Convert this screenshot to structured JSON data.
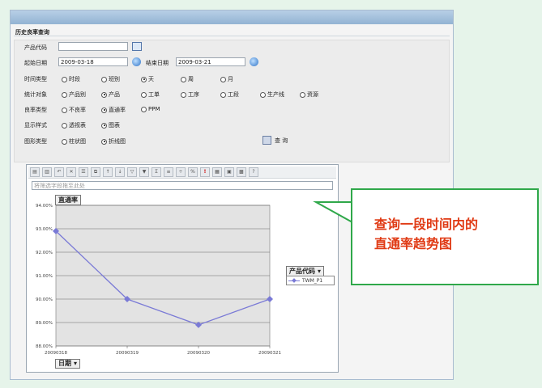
{
  "panel": {
    "title": "历史良率查询"
  },
  "form": {
    "product_code_label": "产品代码",
    "product_code_value": "",
    "start_date_label": "起始日期",
    "start_date_value": "2009-03-18",
    "end_date_label": "结束日期",
    "end_date_value": "2009-03-21",
    "time_type_label": "时间类型",
    "time_type_options": [
      "时段",
      "班别",
      "天",
      "周",
      "月"
    ],
    "time_type_selected": "天",
    "stat_object_label": "统计对象",
    "stat_object_options": [
      "产品别",
      "产品",
      "工单",
      "工序",
      "工段",
      "生产线",
      "资源"
    ],
    "stat_object_selected": "产品",
    "yield_type_label": "良率类型",
    "yield_type_options": [
      "不良率",
      "直通率",
      "PPM"
    ],
    "yield_type_selected": "直通率",
    "display_style_label": "显示样式",
    "display_style_options": [
      "透视表",
      "图表"
    ],
    "display_style_selected": "图表",
    "graph_type_label": "图形类型",
    "graph_type_options": [
      "柱状图",
      "折线图"
    ],
    "graph_type_selected": "折线图",
    "query_label": "查 询"
  },
  "pivot": {
    "filter_placeholder": "将筛选字段拖至此处",
    "measure_field": "直通率",
    "category_field": "日期",
    "series_field": "产品代码"
  },
  "chart_data": {
    "type": "line",
    "categories": [
      "20090318",
      "20090319",
      "20090320",
      "20090321"
    ],
    "series": [
      {
        "name": "TWM_P1",
        "values": [
          92.9,
          90.0,
          88.9,
          90.0
        ]
      }
    ],
    "ylim": [
      88.0,
      94.0
    ],
    "yticks": [
      "94.00%",
      "93.00%",
      "92.00%",
      "91.00%",
      "90.00%",
      "89.00%",
      "88.00%"
    ],
    "line_color": "#7a7ad6",
    "plot_bg": "#e3e3e3",
    "grid": true,
    "legend": "right"
  },
  "callout": {
    "line1": "查询一段时间内的",
    "line2": "直通率趋势图",
    "border_color": "#2fa84a",
    "text_color": "#e03a14"
  }
}
